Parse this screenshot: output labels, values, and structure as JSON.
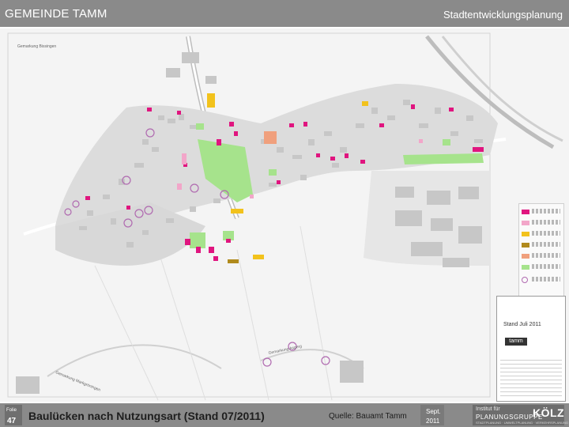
{
  "header": {
    "org": "GEMEINDE TAMM",
    "department": "Stadtentwicklungsplanung"
  },
  "map": {
    "colors": {
      "background": "#f4f4f4",
      "buildings": "#c7c7c7",
      "roads": "#ffffff",
      "green": "#a6e38c",
      "magenta": "#e0157f",
      "pink_light": "#f2a6c9",
      "yellow": "#f2c21c",
      "brown": "#b08a1c",
      "orange": "#f0a07d",
      "circle": "#b06ab0"
    },
    "place_label_1": "Gemarkung Bissingen",
    "place_label_2": "Gemarkung Asperg",
    "place_label_3": "Gemarkung Markgröningen",
    "titleblock": {
      "stand": "Stand Juli 2011",
      "logo": "tamm"
    }
  },
  "footer": {
    "folie_label": "Folie",
    "folie_number": "47",
    "title": "Baulücken nach Nutzungsart (Stand 07/2011)",
    "source": "Quelle: Bauamt Tamm",
    "date_line1": "Sept.",
    "date_line2": "2011",
    "planner_line1": "Institut für",
    "planner_line2": "PLANUNGSGRUPPE",
    "planner_kolz": "KÖLZ",
    "planner_line3": "STADTPLANUNG · UMWELTPLANUNG · VERKEHRSPLANUNG"
  }
}
